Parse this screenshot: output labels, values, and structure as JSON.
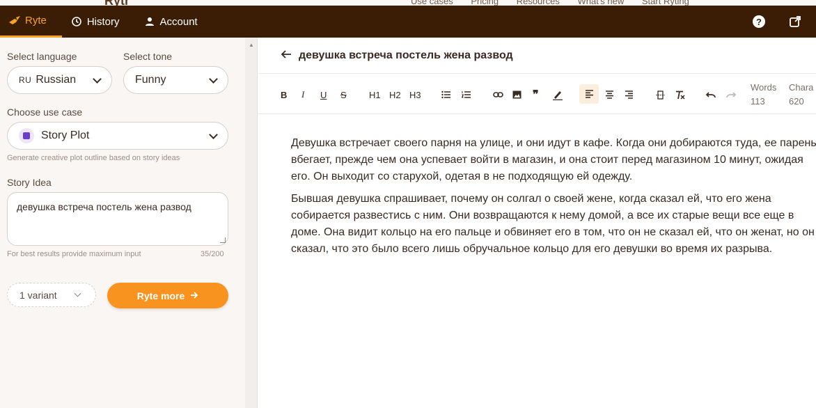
{
  "background": {
    "logo": "Rytr",
    "nav": [
      "Use cases",
      "Pricing",
      "Resources",
      "What's new",
      "Start Ryting"
    ]
  },
  "topbar": {
    "tabs": [
      {
        "label": "Ryte",
        "icon": "hand-pen-icon",
        "active": true
      },
      {
        "label": "History",
        "icon": "history-icon",
        "active": false
      },
      {
        "label": "Account",
        "icon": "user-icon",
        "active": false
      }
    ],
    "accent": "#f9a324",
    "bg": "#3b1d06"
  },
  "sidebar": {
    "language_label": "Select language",
    "language_flag": "RU",
    "language_value": "Russian",
    "tone_label": "Select tone",
    "tone_value": "Funny",
    "usecase_label": "Choose use case",
    "usecase_value": "Story Plot",
    "usecase_hint": "Generate creative plot outline based on story ideas",
    "idea_label": "Story Idea",
    "idea_value": "девушка встреча постель жена развод",
    "idea_hint": "For best results provide maximum input",
    "idea_count": "35/200",
    "variant_value": "1 variant",
    "ryte_more_label": "Ryte more",
    "button_color": "#f7931e"
  },
  "editor": {
    "title": "девушка встреча постель жена развод",
    "toolbar": {
      "bold": "B",
      "italic": "I",
      "underline": "U",
      "strike": "S",
      "h1": "H1",
      "h2": "H2",
      "h3": "H3"
    },
    "words_label": "Words",
    "words_value": "113",
    "chars_label": "Chara",
    "chars_value": "620",
    "paragraphs": [
      "Девушка встречает своего парня на улице, и они идут в кафе. Когда они добираются туда, ее парень вбегает, прежде чем она успевает войти в магазин, и она стоит перед магазином 10 минут, ожидая его. Он выходит со старухой, одетая в не подходящую ей одежду.",
      "Бывшая девушка спрашивает, почему он солгал о своей жене, когда сказал ей, что его жена собирается развестись с ним. Они возвращаются к нему домой, а все их старые вещи все еще в доме. Она видит кольцо на его пальце и обвиняет его в том, что он не сказал ей, что он женат, но он сказал, что это было всего лишь обручальное кольцо для его девушки во время их разрыва."
    ]
  }
}
